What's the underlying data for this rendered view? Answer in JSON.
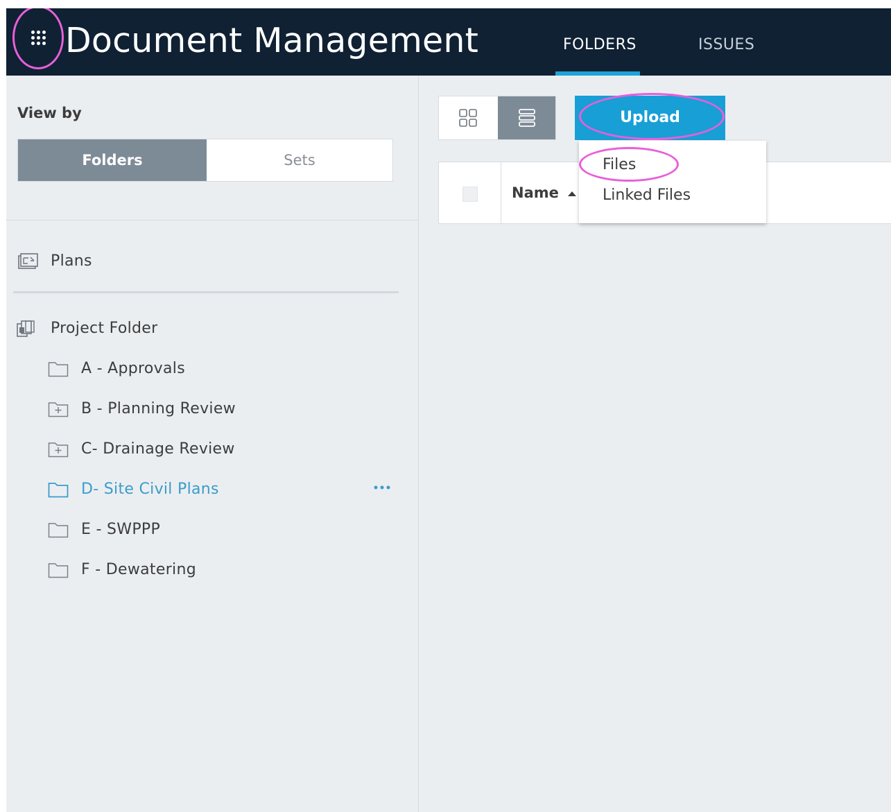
{
  "header": {
    "app_title": "Document Management",
    "tabs": [
      {
        "label": "FOLDERS",
        "active": true
      },
      {
        "label": "ISSUES",
        "active": false
      }
    ],
    "app_switcher_icon": "grid-dots-icon"
  },
  "sidebar": {
    "view_by_label": "View by",
    "view_toggle": {
      "folders": "Folders",
      "sets": "Sets",
      "selected": "Folders"
    },
    "plans": {
      "label": "Plans",
      "icon": "plans-icon"
    },
    "project_folder": {
      "label": "Project Folder",
      "icon": "project-folder-icon",
      "items": [
        {
          "label": "A - Approvals",
          "icon": "folder-icon",
          "expandable": false
        },
        {
          "label": "B - Planning Review",
          "icon": "folder-plus-icon",
          "expandable": true
        },
        {
          "label": "C- Drainage Review",
          "icon": "folder-plus-icon",
          "expandable": true
        },
        {
          "label": "D- Site Civil Plans",
          "icon": "folder-icon",
          "expandable": false,
          "active": true
        },
        {
          "label": "E - SWPPP",
          "icon": "folder-icon",
          "expandable": false
        },
        {
          "label": "F - Dewatering",
          "icon": "folder-icon",
          "expandable": false
        }
      ]
    }
  },
  "toolbar": {
    "view_mode": "list",
    "upload_label": "Upload",
    "upload_menu": [
      "Files",
      "Linked Files"
    ]
  },
  "table": {
    "columns": [
      {
        "label": "Name",
        "sort": "ascending"
      }
    ]
  },
  "colors": {
    "header_bg": "#0f2133",
    "accent": "#179fd6",
    "active_item": "#3a9ccb",
    "highlight_annotation": "#e85fd9"
  }
}
